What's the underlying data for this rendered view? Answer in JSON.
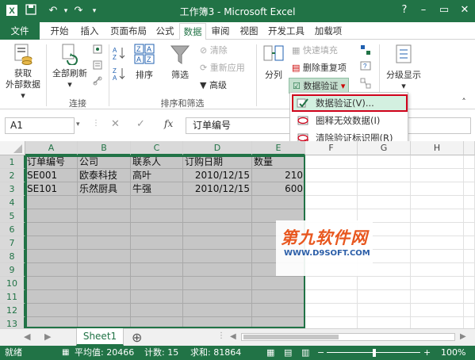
{
  "titlebar": {
    "title": "工作簿3 - Microsoft Excel",
    "help": "?",
    "minimize": "–",
    "restore": "▭",
    "close": "✕"
  },
  "tabs": [
    {
      "label": "文件"
    },
    {
      "label": "开始"
    },
    {
      "label": "插入"
    },
    {
      "label": "页面布局"
    },
    {
      "label": "公式"
    },
    {
      "label": "数据"
    },
    {
      "label": "审阅"
    },
    {
      "label": "视图"
    },
    {
      "label": "开发工具"
    },
    {
      "label": "加载项"
    }
  ],
  "ribbon": {
    "get_external_1": "获取",
    "get_external_2": "外部数据",
    "refresh_all": "全部刷新",
    "connections_group": "连接",
    "sort": "排序",
    "filter": "筛选",
    "clear": "清除",
    "reapply": "重新应用",
    "advanced": "高级",
    "sort_filter_group": "排序和筛选",
    "text_to_columns": "分列",
    "flash_fill": "快速填充",
    "remove_duplicates": "删除重复项",
    "data_validation": "数据验证",
    "outline": "分级显示"
  },
  "dropdown": {
    "items": [
      {
        "label": "数据验证(V)..."
      },
      {
        "label": "圈释无效数据(I)"
      },
      {
        "label": "清除验证标识圈(R)"
      }
    ]
  },
  "formula_bar": {
    "name_box": "A1",
    "fx": "fx",
    "content": "订单编号"
  },
  "grid": {
    "columns": [
      "A",
      "B",
      "C",
      "D",
      "E",
      "F",
      "G",
      "H"
    ],
    "rows": [
      "1",
      "2",
      "3",
      "4",
      "5",
      "6",
      "7",
      "8",
      "9",
      "10",
      "11",
      "12",
      "13"
    ],
    "data": [
      [
        "订单编号",
        "公司",
        "联系人",
        "订购日期",
        "数量"
      ],
      [
        "SE001",
        "欧泰科技",
        "高叶",
        "2010/12/15",
        "210"
      ],
      [
        "SE101",
        "乐然厨具",
        "牛强",
        "2010/12/15",
        "600"
      ]
    ]
  },
  "watermark": {
    "main": "第九软件网",
    "sub": "WWW.D9SOFT.COM"
  },
  "sheets": {
    "active": "Sheet1",
    "add": "⊕"
  },
  "status": {
    "ready": "就绪",
    "average": "平均值: 20466",
    "count": "计数: 15",
    "sum": "求和: 81864",
    "zoom": "100%"
  },
  "colors": {
    "accent": "#217346",
    "highlight_border": "#d0021b",
    "selection": "#c6c6c6"
  }
}
